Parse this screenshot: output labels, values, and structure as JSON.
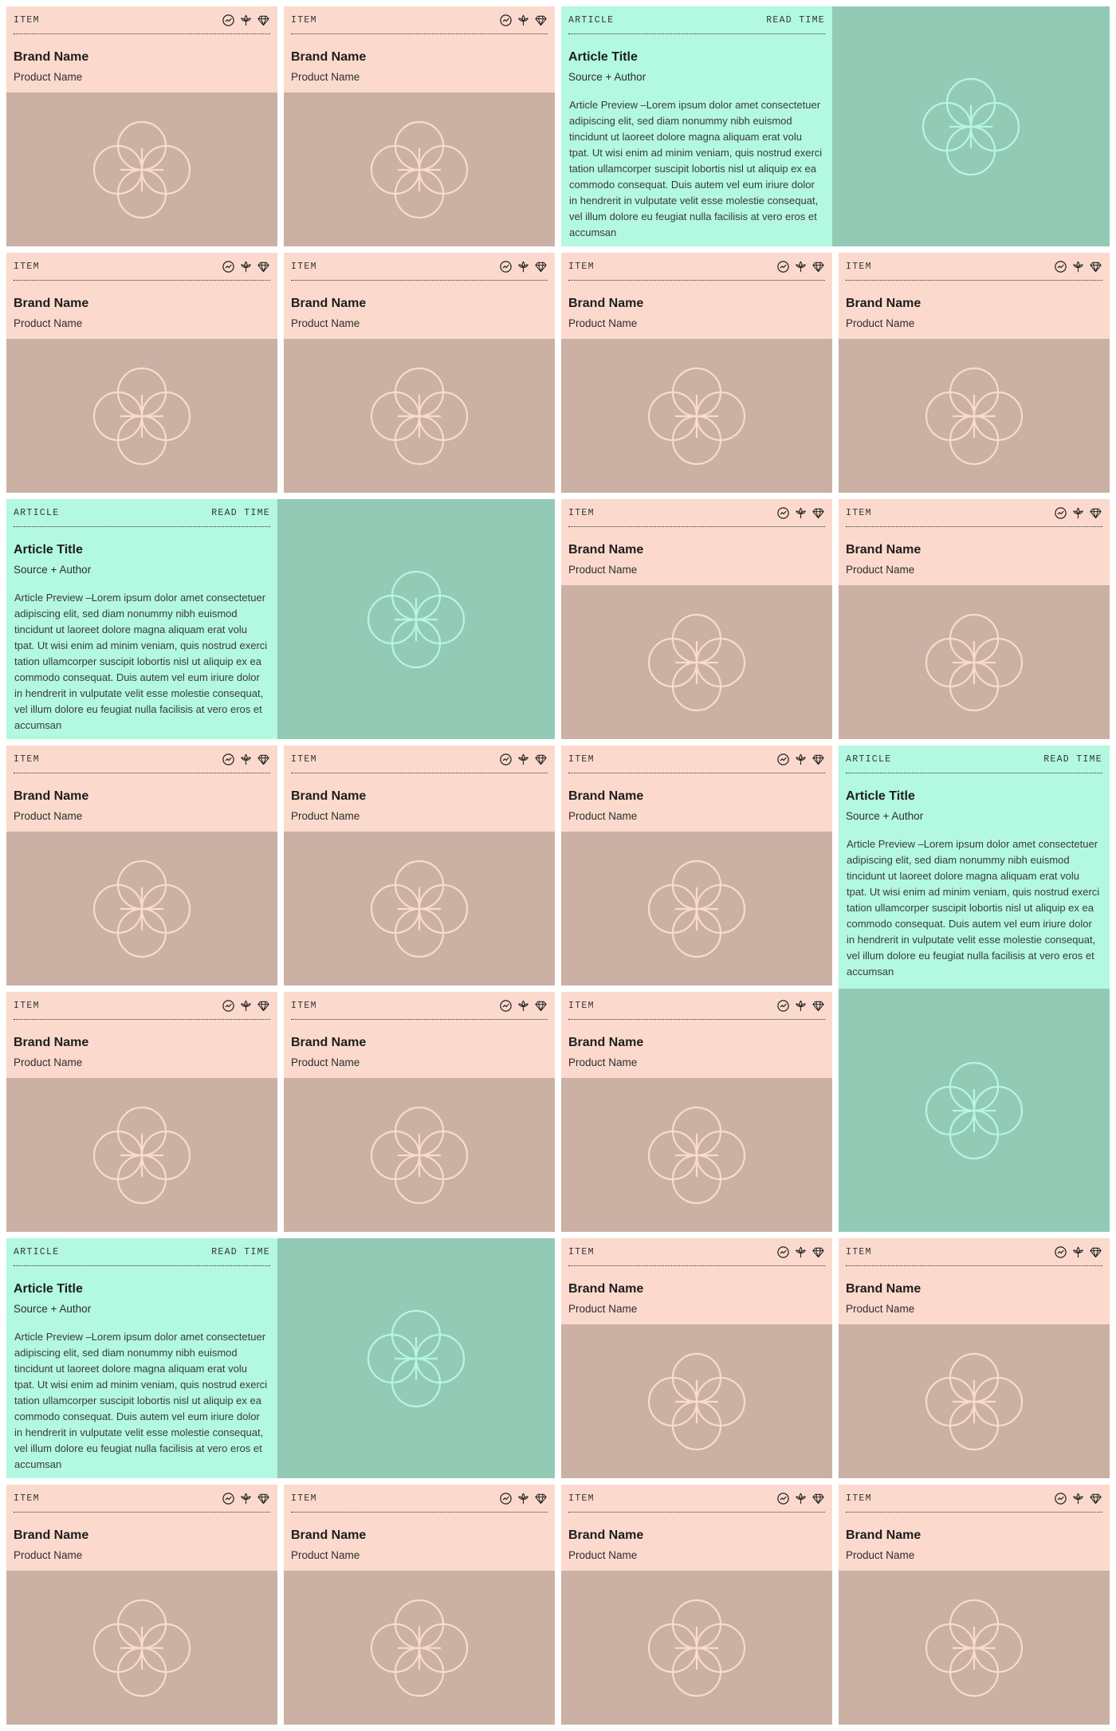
{
  "labels": {
    "item_tag": "ITEM",
    "article_tag": "ARTICLE",
    "read_time": "READ TIME",
    "brand": "Brand Name",
    "product": "Product Name",
    "article_title": "Article Title",
    "source": "Source + Author",
    "preview": "Article Preview –Lorem ipsum dolor amet consectetuer adipiscing elit, sed diam nonummy nibh euismod tincidunt ut laoreet dolore magna aliquam erat volu tpat. Ut wisi enim ad minim veniam, quis nostrud exerci tation ullamcorper suscipit lobortis nisl ut aliquip ex ea commodo consequat. Duis autem vel eum iriure dolor in hendrerit in vulputate velit esse molestie consequat, vel illum dolore eu feugiat nulla facilisis at vero eros et accumsan"
  },
  "icons": [
    "check-circle-icon",
    "plant-icon",
    "diamond-icon"
  ],
  "colors": {
    "item_panel": "#fbdacd",
    "item_media": "#cbb0a4",
    "item_flower": "#fbdacd",
    "article_panel": "#b3f8e0",
    "article_media": "#93cab6",
    "article_flower": "#b3f8e0"
  },
  "grid": [
    [
      "item",
      "item",
      "article-horizontal",
      "article-horizontal"
    ],
    [
      "item",
      "item",
      "item",
      "item"
    ],
    [
      "article-horizontal",
      "article-horizontal",
      "item",
      "item"
    ],
    [
      "item",
      "item",
      "item",
      "article-vertical"
    ],
    [
      "item",
      "item",
      "item",
      "article-vertical"
    ],
    [
      "article-horizontal",
      "article-horizontal",
      "item",
      "item"
    ],
    [
      "item",
      "item",
      "item",
      "item"
    ]
  ]
}
